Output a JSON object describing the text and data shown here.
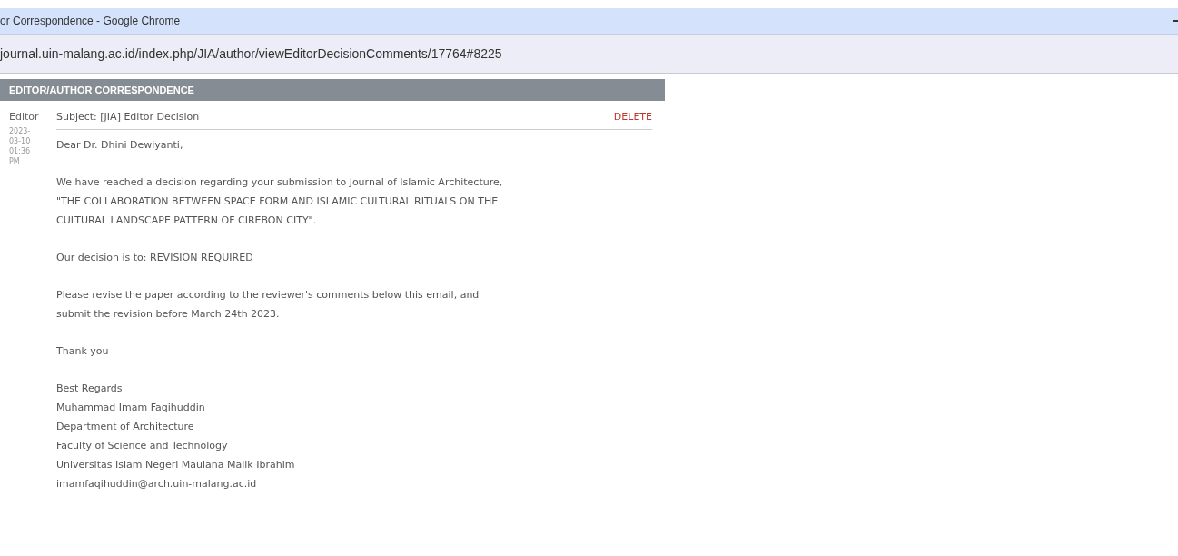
{
  "window": {
    "title": "or Correspondence - Google Chrome"
  },
  "address_bar": {
    "url": "journal.uin-malang.ac.id/index.php/JIA/author/viewEditorDecisionComments/17764#8225"
  },
  "panel": {
    "heading": "EDITOR/AUTHOR CORRESPONDENCE"
  },
  "message": {
    "sender": "Editor",
    "date_lines": [
      "2023-",
      "03-10",
      "01:36",
      "PM"
    ],
    "subject": "Subject: [JIA] Editor Decision",
    "delete_link": "DELETE",
    "paragraphs": [
      [
        "Dear Dr. Dhini Dewiyanti,"
      ],
      [
        "We have reached a decision regarding your submission to Journal of Islamic Architecture,",
        "\"THE COLLABORATION BETWEEN SPACE FORM AND ISLAMIC CULTURAL RITUALS ON THE",
        "CULTURAL LANDSCAPE PATTERN OF CIREBON CITY\"."
      ],
      [
        "Our decision is to: REVISION REQUIRED"
      ],
      [
        "Please revise the paper according to the reviewer's comments below this email, and",
        "submit the revision before March 24th 2023."
      ],
      [
        "Thank you"
      ],
      [
        "Best Regards",
        "Muhammad Imam Faqihuddin",
        "Department of Architecture",
        "Faculty of Science and Technology",
        "Universitas Islam Negeri Maulana Malik Ibrahim",
        "imamfaqihuddin@arch.uin-malang.ac.id"
      ]
    ]
  }
}
